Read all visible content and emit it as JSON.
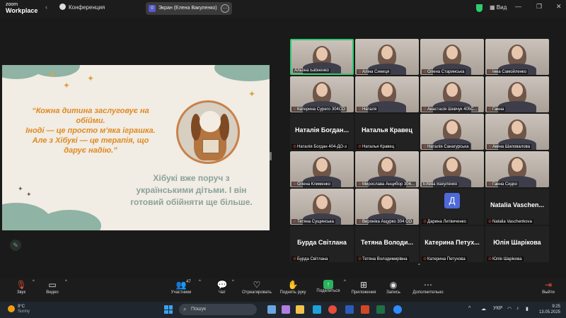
{
  "app": {
    "logo_line1": "zoom",
    "logo_line2": "Workplace",
    "conference_label": "Конференция",
    "share_indicator": "Экран (Елена Вакуленко)",
    "share_icon_letter": "0",
    "view_label": "Вид"
  },
  "slide": {
    "quote_lines": [
      "“Кожна дитина заслуговує на",
      "обійми.",
      "Іноді — це просто м'яка іграшка.",
      "Але з Хібукі — це терапія, що",
      "дарує надію.”"
    ],
    "subtitle_lines": [
      "Хібукі вже поруч з",
      "українськими дітьми. І він",
      "готовий обійняти ще більше."
    ]
  },
  "gallery": {
    "tiles": [
      {
        "name": "Альона Бабненко",
        "type": "video",
        "muted": false,
        "active": true
      },
      {
        "name": "Аліна Синиця",
        "type": "video",
        "muted": true
      },
      {
        "name": "Олена Старинська",
        "type": "video",
        "muted": true
      },
      {
        "name": "Інна Самойленко",
        "type": "video",
        "muted": true
      },
      {
        "name": "Катерина Сурего 304CO",
        "type": "video",
        "muted": true
      },
      {
        "name": "Наталя",
        "type": "video",
        "muted": true
      },
      {
        "name": "Анастасія Шевчук 405C...",
        "type": "video",
        "muted": true
      },
      {
        "name": "Ганна",
        "type": "video",
        "muted": true
      },
      {
        "name": "Наталія Богдан 404-ДО-з",
        "type": "text",
        "big": "Наталія Богдан...",
        "muted": true
      },
      {
        "name": "Наталья Кравец",
        "type": "text",
        "big": "Наталья Кравец",
        "muted": true
      },
      {
        "name": "Наталія Санагурська",
        "type": "video",
        "muted": true
      },
      {
        "name": "Аміна Шаповалова",
        "type": "video",
        "muted": true
      },
      {
        "name": "Олена Клименко",
        "type": "video",
        "muted": true
      },
      {
        "name": "Мирослава Анцибор 304...",
        "type": "video",
        "muted": true
      },
      {
        "name": "Елена Вакуленко",
        "type": "video",
        "muted": false
      },
      {
        "name": "Ганна Сидко",
        "type": "video",
        "muted": true
      },
      {
        "name": "Тетяна Сущинська",
        "type": "video",
        "muted": true
      },
      {
        "name": "Вероніка Ащурко 304 CO",
        "type": "video",
        "muted": true
      },
      {
        "name": "Дарина Литвиченко",
        "type": "avatar",
        "letter": "Д",
        "muted": true
      },
      {
        "name": "Natalia Vaschenkova",
        "type": "text",
        "big": "Natalia Vaschen...",
        "muted": true
      },
      {
        "name": "Бурда Світлана",
        "type": "text",
        "big": "Бурда Світлана",
        "muted": true
      },
      {
        "name": "Тетяна Володимирівна",
        "type": "text",
        "big": "Тетяна Володи...",
        "muted": true
      },
      {
        "name": "Катерина Петухова",
        "type": "text",
        "big": "Катерина Петух...",
        "muted": true
      },
      {
        "name": "Юлія Шарікова",
        "type": "text",
        "big": "Юлія Шарікова",
        "muted": true
      }
    ]
  },
  "toolbar": {
    "audio": "Звук",
    "video": "Видео",
    "participants": "Участники",
    "participants_count": "47",
    "chat": "Чат",
    "react": "Отреагировать",
    "raise_hand": "Поднять руку",
    "share": "Поделиться",
    "apps": "Приложения",
    "record": "Запись",
    "more": "Дополнительно",
    "leave": "Выйти"
  },
  "taskbar": {
    "temp": "9°C",
    "weather": "Sunny",
    "search_placeholder": "Пошук",
    "lang": "УКР",
    "time": "9:25",
    "date": "13.05.2025"
  },
  "colors": {
    "active_speaker": "#2ecc71",
    "muted": "#e74c3c",
    "quote": "#e08a22",
    "subtitle": "#8ba29a"
  }
}
